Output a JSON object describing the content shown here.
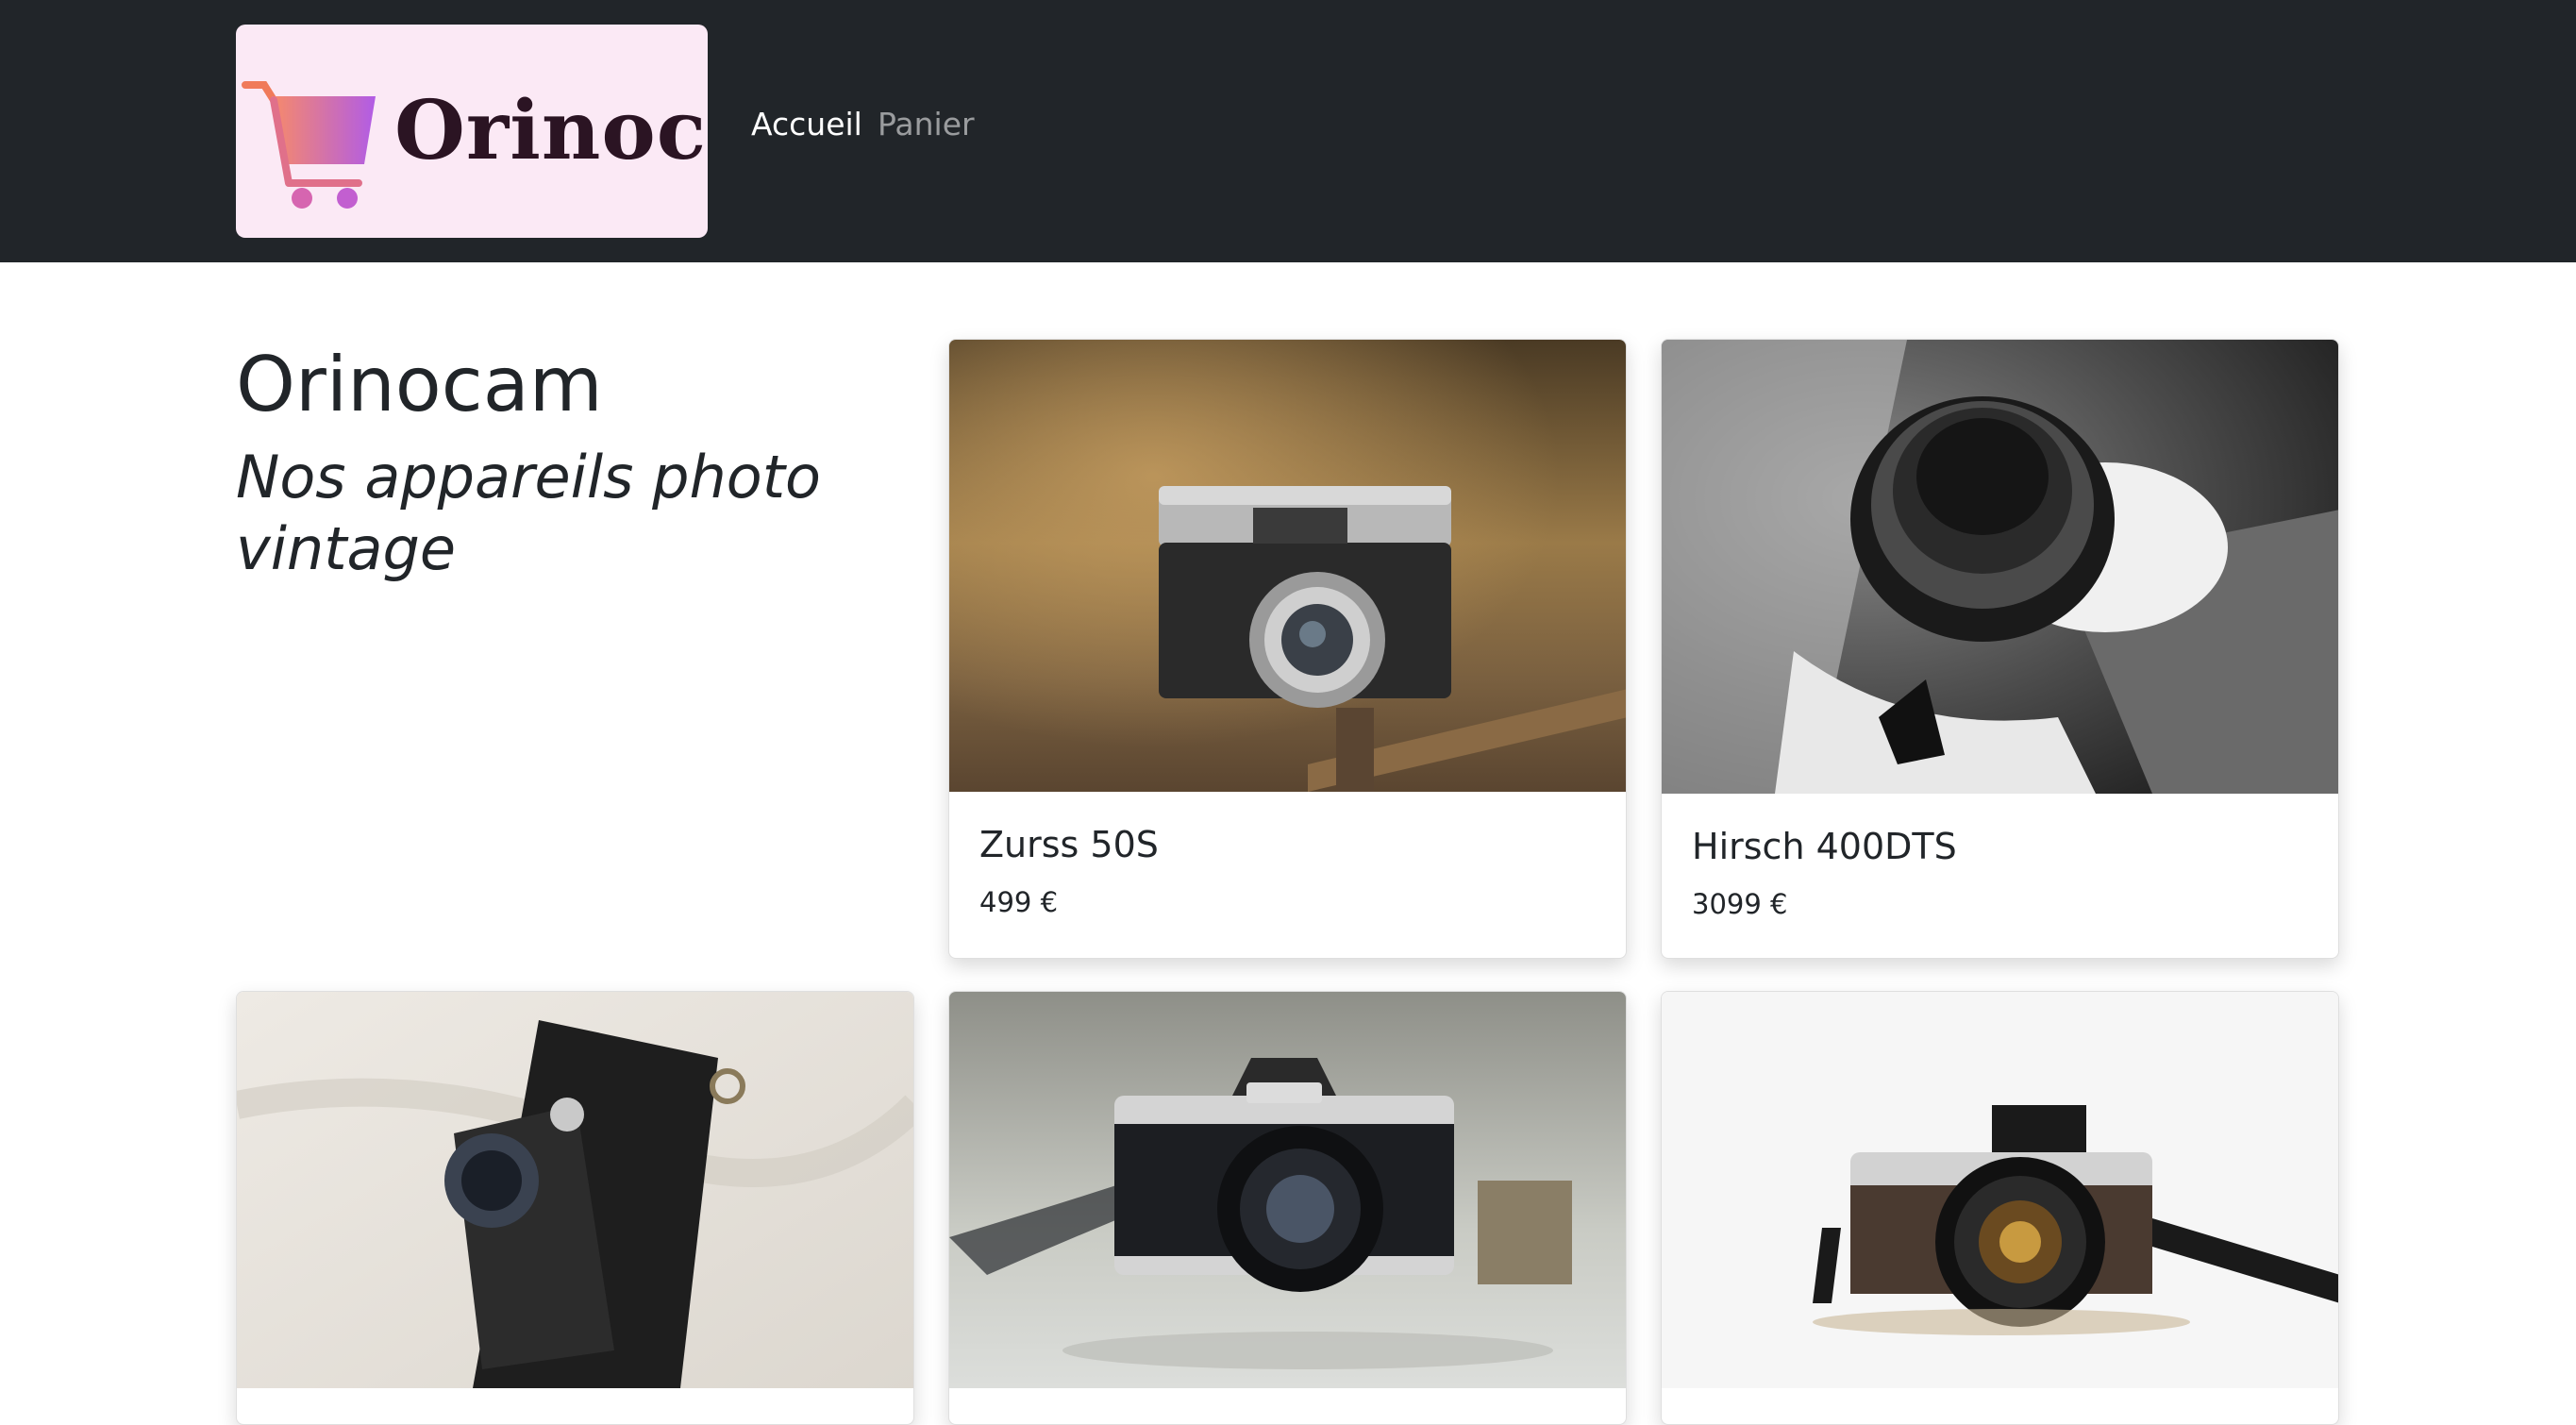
{
  "header": {
    "logo_text": "Orinoco",
    "nav": {
      "home_label": "Accueil",
      "cart_label": "Panier"
    }
  },
  "intro": {
    "title": "Orinocam",
    "subtitle": "Nos appareils photo vintage"
  },
  "products": [
    {
      "name": "Zurss 50S",
      "price": "499 €",
      "image": "vintage-rangefinder-camera-photo"
    },
    {
      "name": "Hirsch 400DTS",
      "price": "3099 €",
      "image": "black-white-camera-lens-photo"
    },
    {
      "name": "",
      "price": "",
      "image": "folding-bellows-camera-photo"
    },
    {
      "name": "",
      "price": "",
      "image": "minolta-slr-camera-photo"
    },
    {
      "name": "",
      "price": "",
      "image": "silver-black-camera-photo"
    }
  ],
  "colors": {
    "navbar_bg": "#212529",
    "logo_bg": "#fbe9f5",
    "cart_gradient_start": "#f78a6a",
    "cart_gradient_end": "#b15ce6"
  }
}
